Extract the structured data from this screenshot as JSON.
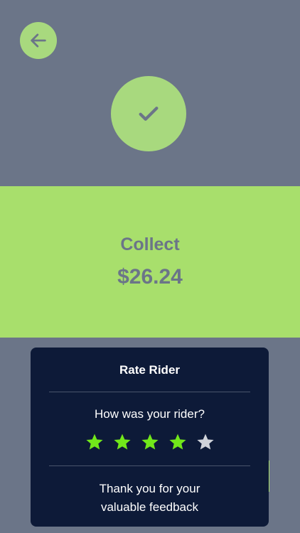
{
  "header": {
    "back_icon": "arrow-left-icon",
    "status_icon": "checkmark-icon"
  },
  "collect": {
    "label": "Collect",
    "amount": "$26.24"
  },
  "rating_card": {
    "title": "Rate Rider",
    "question": "How was your rider?",
    "rating": 4,
    "max_rating": 5,
    "thanks_line1": "Thank you for your",
    "thanks_line2": "valuable feedback"
  },
  "colors": {
    "background": "#6b7588",
    "accent_green": "#a8df6c",
    "card_bg": "#0d1a38",
    "star_filled": "#72e81a",
    "star_empty": "#d0d3da"
  }
}
